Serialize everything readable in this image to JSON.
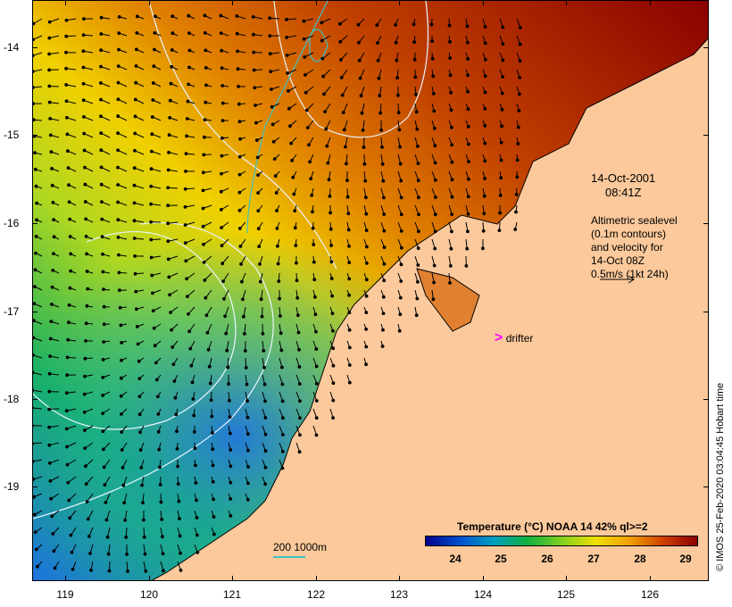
{
  "map": {
    "latitude_labels": [
      "-14",
      "-15",
      "-16",
      "-17",
      "-18",
      "-19"
    ],
    "longitude_labels": [
      "119",
      "120",
      "121",
      "122",
      "123",
      "124",
      "125",
      "126"
    ],
    "colors": {
      "land": "#fbc99b",
      "coastline": "#000000",
      "contour": "#e8f4ff",
      "isobath": "#40c0c0",
      "drifter": "#ff00ff"
    }
  },
  "annotation": {
    "date": "14-Oct-2001",
    "time": "08:41Z",
    "legend_lines": [
      "Altimetric sealevel",
      "(0.1m contours)",
      "and velocity for",
      "14-Oct 08Z",
      "0.5m/s (1kt 24h)"
    ],
    "drifter_symbol": ">",
    "drifter_label": "drifter"
  },
  "depth_legend": {
    "label": "200  1000m"
  },
  "colorbar": {
    "title": "Temperature (°C) NOAA 14 42% ql>=2",
    "ticks": [
      "24",
      "25",
      "26",
      "27",
      "28",
      "29"
    ],
    "colors": [
      "#00008b",
      "#0050d0",
      "#00a0c0",
      "#10b040",
      "#80d020",
      "#f0e000",
      "#f0a000",
      "#d04000",
      "#8b0000"
    ]
  },
  "credit": "© IMOS 25-Feb-2020 03:04:45 Hobart time"
}
